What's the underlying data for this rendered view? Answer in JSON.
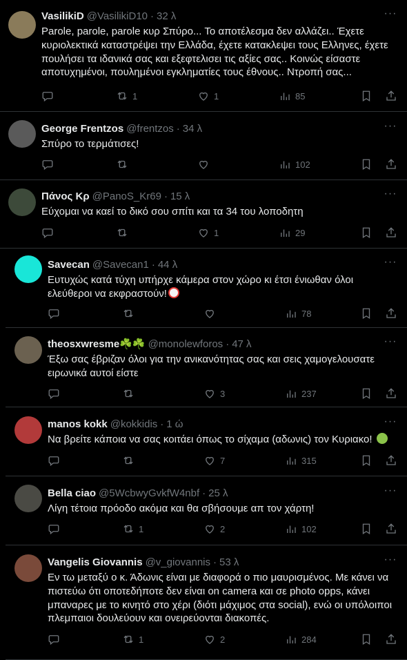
{
  "tweets": [
    {
      "name": "VasilikiD",
      "handle": "@VasilikiD10",
      "sep": "·",
      "time": "32 λ",
      "text": "Parole, parole, parole κυρ Σπύρο... Το αποτέλεσμα δεν αλλάζει.. Έχετε κυριολεκτικά καταστρέψει την Ελλάδα, έχετε κατακλεψει τους Ελληνες, έχετε πουλήσει τα ιδανικά σας και εξεφτελισει τις αξίες σας.. Κοινώς είσαστε αποτυχημένοι, πουλημένοι εγκληματίες τους έθνους.. Ντροπή σας...",
      "retweets": "1",
      "likes": "1",
      "views": "85",
      "more": "···",
      "avatar_color": "#8a7b5a"
    },
    {
      "name": "George Frentzos",
      "handle": "@frentzos",
      "sep": "·",
      "time": "34 λ",
      "text": "Σπύρο το τερμάτισες!",
      "retweets": "",
      "likes": "",
      "views": "102",
      "more": "···",
      "avatar_color": "#5a5a5a"
    },
    {
      "name": "Πάνος Κρ",
      "handle": "@PanoS_Kr69",
      "sep": "·",
      "time": "15 λ",
      "text": "Εύχομαι να καεί το δικό σου σπίτι και τα 34 του λοποδητη",
      "retweets": "",
      "likes": "1",
      "views": "29",
      "more": "···",
      "avatar_color": "#3d4a3a"
    },
    {
      "name": "Savecan",
      "handle": "@Savecan1",
      "sep": "·",
      "time": "44 λ",
      "text": "Ευτυχώς κατά τύχη υπήρχε κάμερα στον χώρο κι έτσι ένιωθαν όλοι ελεύθεροι να εκφραστούν!",
      "retweets": "",
      "likes": "",
      "views": "78",
      "more": "···",
      "avatar_color": "#19e6d8",
      "emoji": "clown-emoji"
    },
    {
      "name": "theosxwresme☘️☘️",
      "handle": "@monolewforos",
      "sep": "·",
      "time": "47 λ",
      "text": "Έξω σας έβριζαν όλοι για την ανικανότητας σας και σεις χαμογελουσατε ειρωνικά αυτοί είστε",
      "retweets": "",
      "likes": "3",
      "views": "237",
      "more": "···",
      "avatar_color": "#6b6150"
    },
    {
      "name": "manos kokk",
      "handle": "@kokkidis",
      "sep": "·",
      "time": "1 ώ",
      "text": "Να βρείτε κάποια να σας κοιτάει όπως το σίχαμα (αδωνις) τον Κυριακο!",
      "retweets": "",
      "likes": "7",
      "views": "315",
      "more": "···",
      "avatar_color": "#b23a3a",
      "emoji": "nauseated-emoji"
    },
    {
      "name": "Bella ciao",
      "handle": "@5WcbwyGvkfW4nbf",
      "sep": "·",
      "time": "25 λ",
      "text": "Λίγη τέτοια πρόοδο ακόμα και θα σβήσουμε απ τον χάρτη!",
      "retweets": "1",
      "likes": "2",
      "views": "102",
      "more": "···",
      "avatar_color": "#4a4a44"
    },
    {
      "name": "Vangelis Giovannis",
      "handle": "@v_giovannis",
      "sep": "·",
      "time": "53 λ",
      "text": "Εν τω μεταξύ ο κ. Άδωνις είναι με διαφορά ο πιο μαυρισμένος. Με κάνει να πιστεύω ότι οποτεδήποτε δεν είναι on camera και σε photo opps, κάνει μπαναρες με το κινητό στο χέρι (διότι μάχιμος στα social), ενώ οι υπόλοιποι πλεμπαιοι δουλεύουν και ονειρεύονται διακοπές.",
      "retweets": "1",
      "likes": "2",
      "views": "284",
      "more": "···",
      "avatar_color": "#7a4a3a"
    }
  ]
}
